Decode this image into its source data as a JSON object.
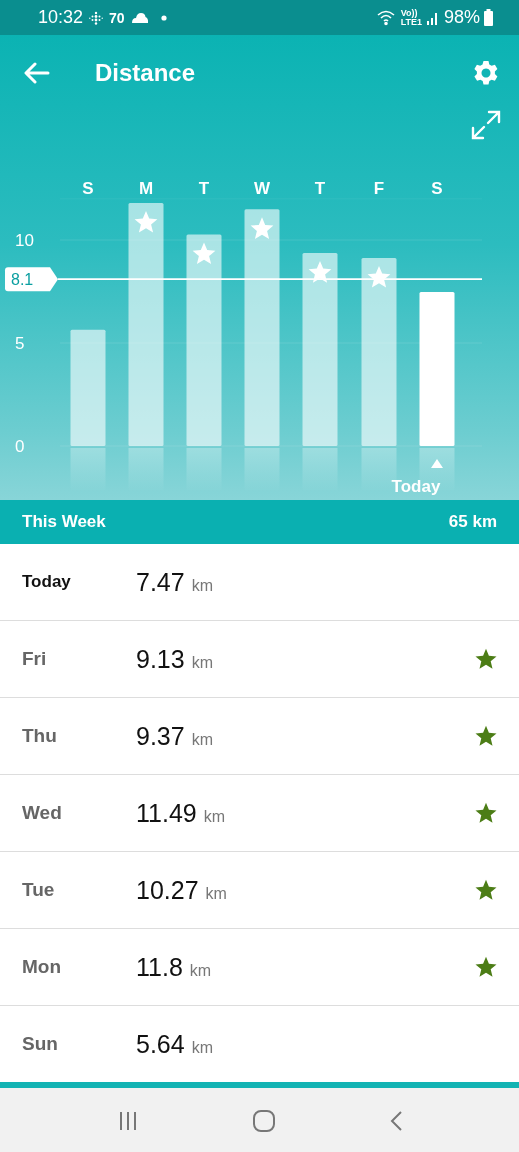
{
  "status_bar": {
    "time": "10:32",
    "temperature": "70",
    "network": [
      "Vo))",
      "LTE1"
    ],
    "battery": "98%"
  },
  "header": {
    "title": "Distance"
  },
  "chart": {
    "bars": [
      {
        "starred": false,
        "selected": false
      },
      {
        "starred": true,
        "selected": false
      },
      {
        "starred": true,
        "selected": false
      },
      {
        "starred": true,
        "selected": false
      },
      {
        "starred": true,
        "selected": false
      },
      {
        "starred": true,
        "selected": false
      },
      {
        "starred": false,
        "selected": true
      }
    ],
    "today_label": "Today",
    "chart_data": {
      "type": "bar",
      "categories": [
        "S",
        "M",
        "T",
        "W",
        "T",
        "F",
        "S"
      ],
      "values": [
        5.64,
        11.8,
        10.27,
        11.49,
        9.37,
        9.13,
        7.47
      ],
      "ylim": [
        0,
        12
      ],
      "yticks": [
        0,
        5,
        10
      ],
      "ref_lines": [
        {
          "axis": "y",
          "value": 8.1,
          "label": "8.1"
        }
      ]
    }
  },
  "summary": {
    "label": "This Week",
    "total": "65 km"
  },
  "days": [
    {
      "day": "Today",
      "value": "7.47",
      "unit": "km",
      "starred": false,
      "current": true
    },
    {
      "day": "Fri",
      "value": "9.13",
      "unit": "km",
      "starred": true,
      "current": false
    },
    {
      "day": "Thu",
      "value": "9.37",
      "unit": "km",
      "starred": true,
      "current": false
    },
    {
      "day": "Wed",
      "value": "11.49",
      "unit": "km",
      "starred": true,
      "current": false
    },
    {
      "day": "Tue",
      "value": "10.27",
      "unit": "km",
      "starred": true,
      "current": false
    },
    {
      "day": "Mon",
      "value": "11.8",
      "unit": "km",
      "starred": true,
      "current": false
    },
    {
      "day": "Sun",
      "value": "5.64",
      "unit": "km",
      "starred": false,
      "current": false
    }
  ]
}
